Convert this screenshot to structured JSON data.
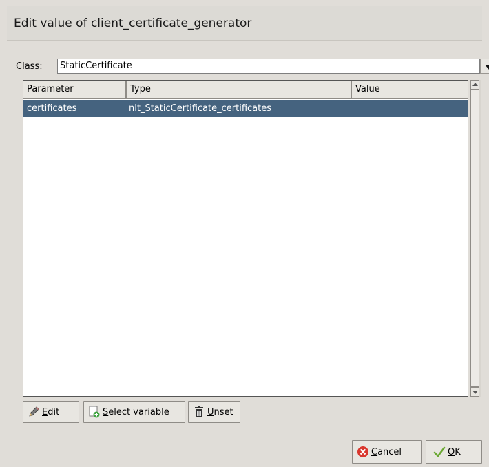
{
  "dialog": {
    "title": "Edit value of client_certificate_generator"
  },
  "class_selector": {
    "label_prefix": "C",
    "label_accel": "l",
    "label_suffix": "ass:",
    "value": "StaticCertificate"
  },
  "table": {
    "columns": [
      "Parameter",
      "Type",
      "Value"
    ],
    "rows": [
      {
        "parameter": "certificates",
        "type": "nlt_StaticCertificate_certificates",
        "value": ""
      }
    ],
    "selected_row_color": "#45637f"
  },
  "buttons": {
    "edit": {
      "accel": "E",
      "rest": "dit",
      "icon": "pencil-icon"
    },
    "select_variable": {
      "accel": "S",
      "rest": "elect variable",
      "icon": "add-variable-icon"
    },
    "unset": {
      "accel": "U",
      "rest": "nset",
      "icon": "trash-icon"
    },
    "cancel": {
      "accel": "C",
      "rest": "ancel",
      "icon": "cancel-icon"
    },
    "ok": {
      "accel": "O",
      "rest": "K",
      "icon": "checkmark-icon"
    }
  }
}
